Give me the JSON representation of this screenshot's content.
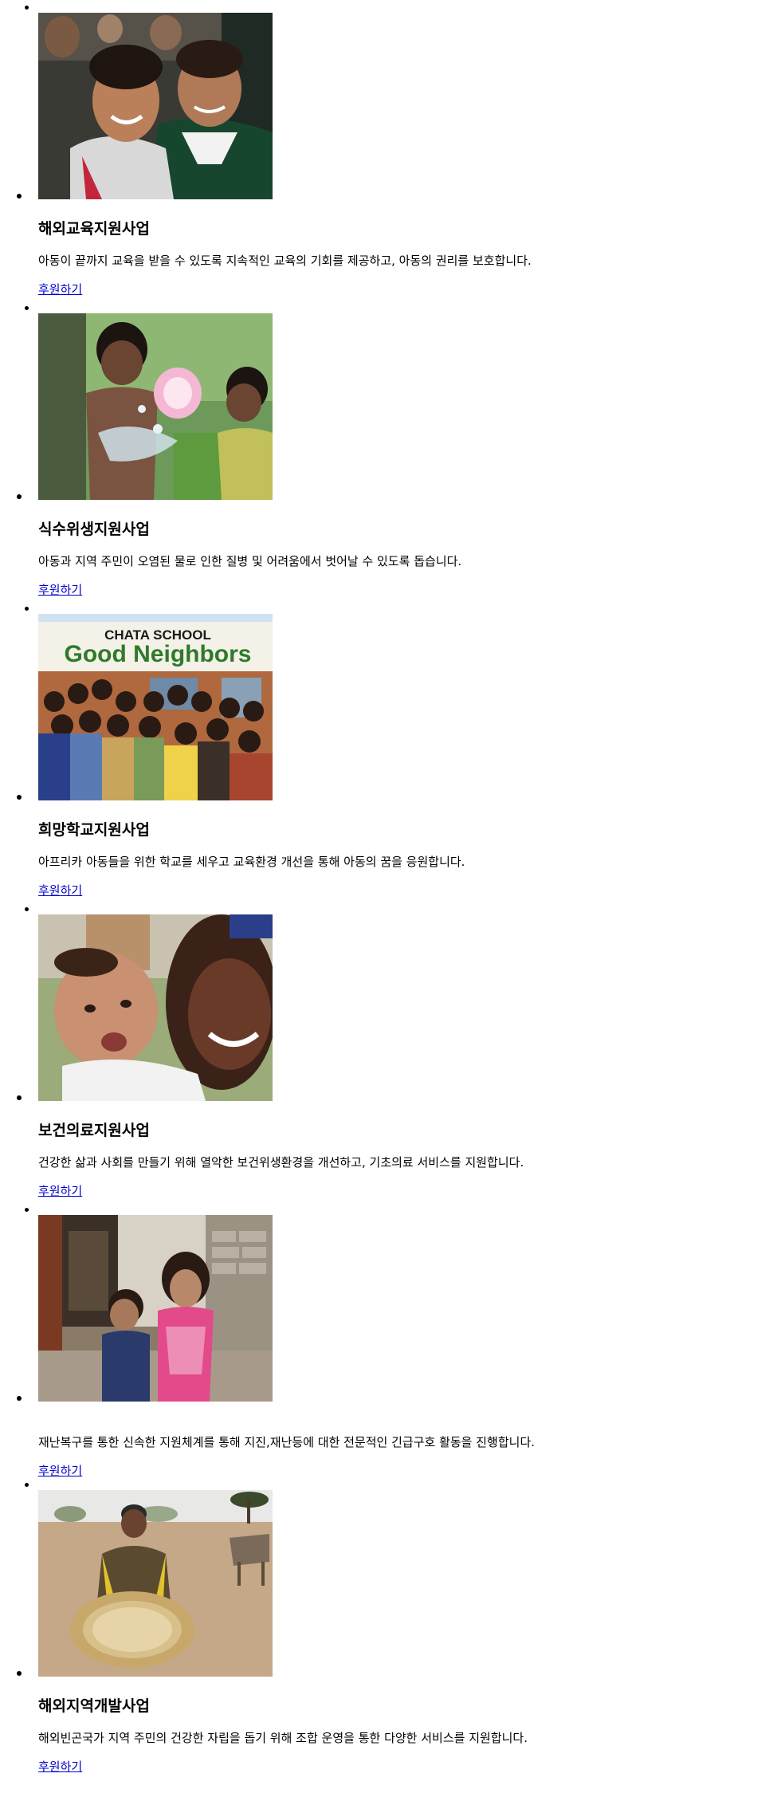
{
  "programs": [
    {
      "title": "해외교육지원사업",
      "description": "아동이 끝까지 교육을 받을 수 있도록 지속적인 교육의 기회를 제공하고, 아동의 권리를 보호합니다.",
      "link": "후원하기",
      "image": "photo-two-smiling-schoolgirls"
    },
    {
      "title": "식수위생지원사업",
      "description": "아동과 지역 주민이 오염된 물로 인한 질병 및 어려움에서 벗어날 수 있도록 돕습니다.",
      "link": "후원하기",
      "image": "photo-children-splashing-water"
    },
    {
      "title": "희망학교지원사업",
      "description": "아프리카 아동들을 위한 학교를 세우고 교육환경 개선을 통해 아동의 꿈을 응원합니다.",
      "link": "후원하기",
      "image": "photo-students-at-school-sign",
      "sign_line1": "CHATA SCHOOL",
      "sign_line2": "Good Neighbors"
    },
    {
      "title": "보건의료지원사업",
      "description": "건강한 삶과 사회를 만들기 위해 열악한 보건위생환경을 개선하고, 기초의료 서비스를 지원합니다.",
      "link": "후원하기",
      "image": "photo-mother-and-baby"
    },
    {
      "title": "",
      "description": "재난복구를 통한 신속한 지원체계를 통해 지진,재난등에 대한 전문적인 긴급구호 활동을 진행합니다.",
      "link": "후원하기",
      "image": "photo-children-by-ruined-house"
    },
    {
      "title": "해외지역개발사업",
      "description": "해외빈곤국가 지역 주민의 건강한 자립을 돕기 위해 조합 운영을 통한 다양한 서비스를 지원합니다.",
      "link": "후원하기",
      "image": "photo-woman-with-grain-basket"
    }
  ],
  "colors": {
    "link": "#0000cc",
    "text": "#000000"
  }
}
